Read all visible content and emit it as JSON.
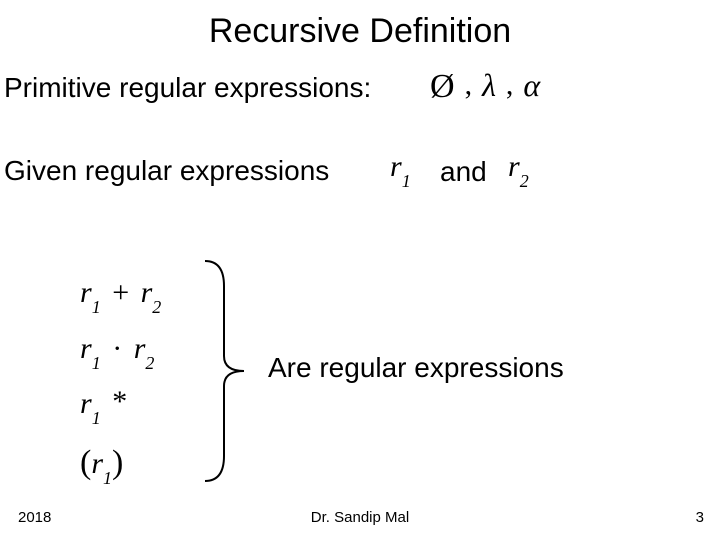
{
  "title": "Recursive Definition",
  "line_primitive": "Primitive regular expressions:",
  "primitives": {
    "empty": "Ø",
    "comma1": ",",
    "lambda": "λ",
    "comma2": ",",
    "alpha": "α"
  },
  "line_given": "Given regular expressions",
  "r1": {
    "var": "r",
    "sub": "1"
  },
  "and_word": "and",
  "r2": {
    "var": "r",
    "sub": "2"
  },
  "exprs": {
    "row1": {
      "a": "r",
      "as": "1",
      "op": "+",
      "b": "r",
      "bs": "2"
    },
    "row2": {
      "a": "r",
      "as": "1",
      "op": "·",
      "b": "r",
      "bs": "2"
    },
    "row3": {
      "a": "r",
      "as": "1",
      "star": "*"
    },
    "row4": {
      "lp": "(",
      "a": "r",
      "as": "1",
      "rp": ")"
    }
  },
  "are_text": "Are regular expressions",
  "footer": {
    "year": "2018",
    "author": "Dr. Sandip Mal",
    "page": "3"
  }
}
